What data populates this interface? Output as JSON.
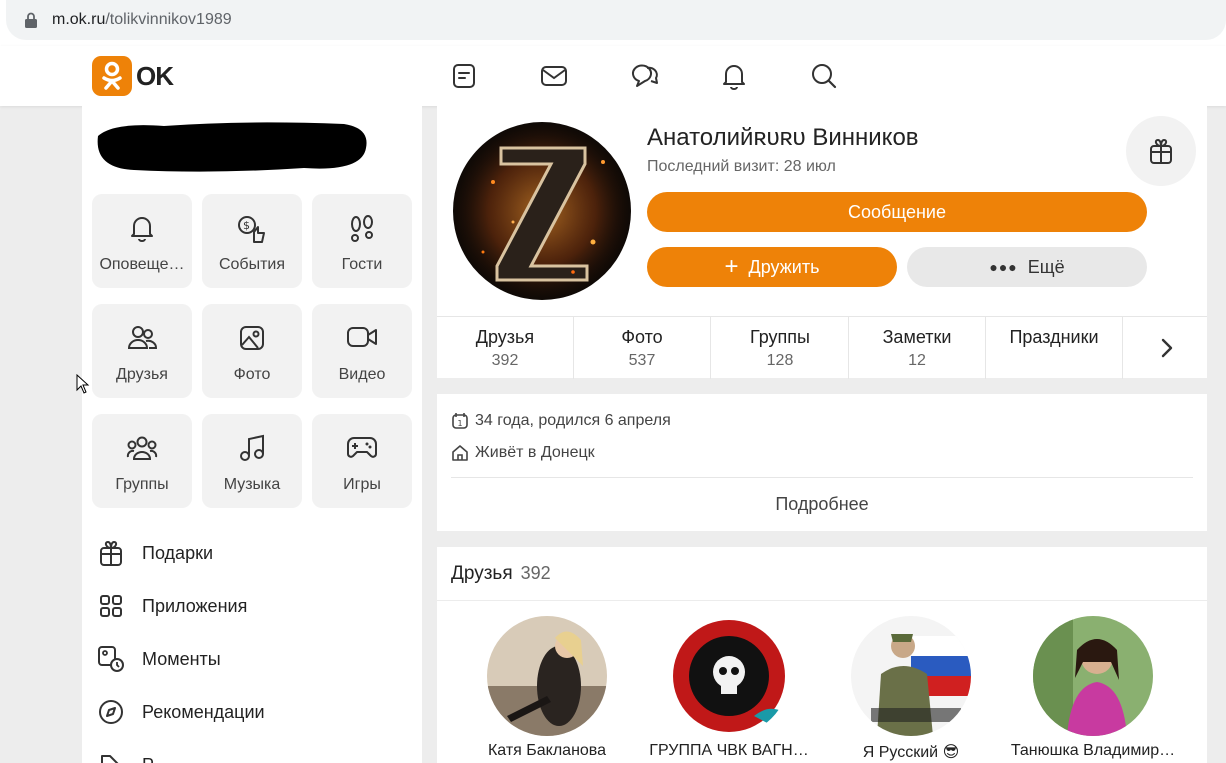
{
  "browser": {
    "url_host": "m.ok.ru",
    "url_path": "/tolikvinnikov1989"
  },
  "brand": {
    "logo_text": "OK",
    "accent": "#ee8208"
  },
  "topnav": {
    "icons": [
      "feed-icon",
      "mail-icon",
      "chat-icon",
      "bell-icon",
      "search-icon"
    ]
  },
  "sidebar": {
    "tiles": [
      {
        "label": "Оповеще…",
        "icon": "bell-icon"
      },
      {
        "label": "События",
        "icon": "events-icon"
      },
      {
        "label": "Гости",
        "icon": "footprints-icon"
      },
      {
        "label": "Друзья",
        "icon": "friends-icon"
      },
      {
        "label": "Фото",
        "icon": "photo-icon"
      },
      {
        "label": "Видео",
        "icon": "video-icon"
      },
      {
        "label": "Группы",
        "icon": "groups-icon"
      },
      {
        "label": "Музыка",
        "icon": "music-icon"
      },
      {
        "label": "Игры",
        "icon": "gamepad-icon"
      }
    ],
    "rows": [
      {
        "label": "Подарки",
        "icon": "gift-icon"
      },
      {
        "label": "Приложения",
        "icon": "apps-icon"
      },
      {
        "label": "Моменты",
        "icon": "moments-icon"
      },
      {
        "label": "Рекомендации",
        "icon": "compass-icon"
      },
      {
        "label": "Р…",
        "icon": "tag-icon"
      }
    ]
  },
  "profile": {
    "name": "Анатолийʀᴜʀᴜ Винников",
    "last_visit": "Последний визит: 28 июл",
    "message_button": "Сообщение",
    "add_friend_button": "Дружить",
    "more_button": "Ещё",
    "avatar_letter": "Z"
  },
  "stats": [
    {
      "label": "Друзья",
      "value": "392"
    },
    {
      "label": "Фото",
      "value": "537"
    },
    {
      "label": "Группы",
      "value": "128"
    },
    {
      "label": "Заметки",
      "value": "12"
    },
    {
      "label": "Праздники",
      "value": ""
    }
  ],
  "info": {
    "age": "34 года, родился 6 апреля",
    "city": "Живёт в Донецк",
    "more_link": "Подробнее"
  },
  "friends": {
    "title": "Друзья",
    "count": "392",
    "items": [
      {
        "name": "Катя Бакланова"
      },
      {
        "name": "ГРУППА ЧВК ВАГН…"
      },
      {
        "name": "Я Русский 😎"
      },
      {
        "name": "Танюшка Владимир…"
      }
    ]
  }
}
